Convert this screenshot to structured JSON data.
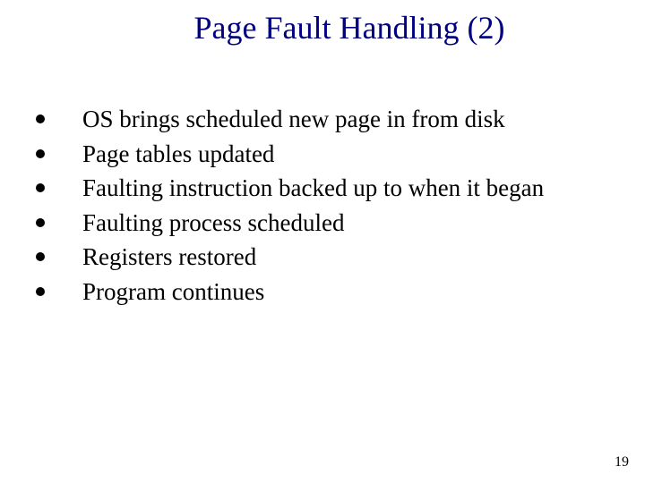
{
  "title": "Page Fault Handling (2)",
  "bullets": [
    "OS brings scheduled new page in from disk",
    "Page tables updated",
    "Faulting instruction backed up to when it began",
    "Faulting process scheduled",
    "Registers restored",
    "Program continues"
  ],
  "page_number": "19"
}
